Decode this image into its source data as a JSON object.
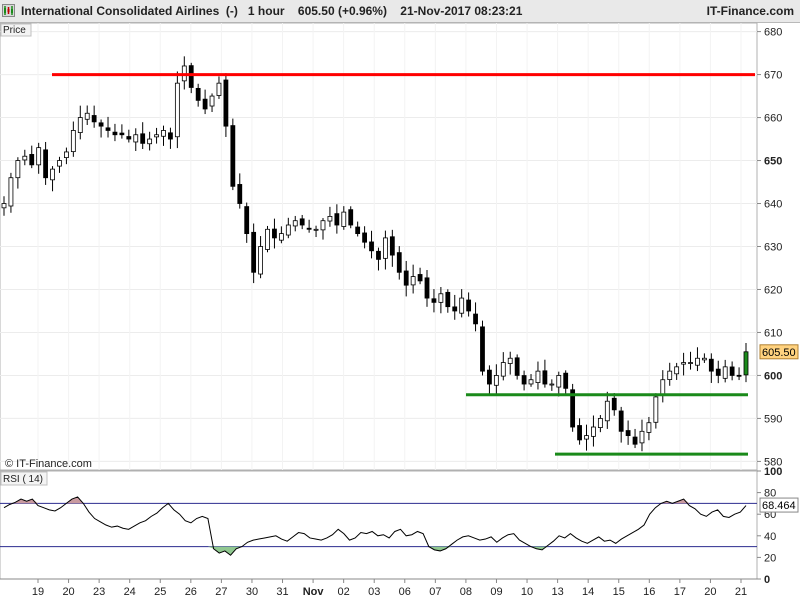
{
  "header": {
    "title": "International Consolidated Airlines  (-)   1 hour    605.50 (+0.96%)    21-Nov-2017 08:23:21",
    "brand": "IT-Finance.com"
  },
  "price_panel": {
    "label": "Price",
    "watermark": "© IT-Finance.com"
  },
  "rsi_panel": {
    "label": "RSI ( 14)"
  },
  "colors": {
    "resistance_line": "#ff0000",
    "support_line": "#1a8a1a",
    "candle": "#000000",
    "bullish": "#1a8a1a",
    "price_tag": "#ffd27f",
    "rsi_overbought_fill": "#c99aa0",
    "rsi_oversold_fill": "#90c890",
    "rsi_line": "#000000",
    "rsi_level_line": "#2b2b8f"
  },
  "chart_data": [
    {
      "type": "candlestick",
      "title": "International Consolidated Airlines",
      "interval": "1 hour",
      "last_price": 605.5,
      "change_pct": "+0.96%",
      "ylim": [
        578,
        682
      ],
      "y_ticks": [
        580,
        590,
        600,
        610,
        620,
        630,
        640,
        650,
        660,
        670,
        680
      ],
      "y_bold_ticks": [
        600,
        650
      ],
      "x_labels": [
        "19",
        "20",
        "23",
        "24",
        "25",
        "26",
        "27",
        "30",
        "31",
        "Nov",
        "02",
        "03",
        "06",
        "07",
        "08",
        "09",
        "10",
        "13",
        "14",
        "15",
        "16",
        "17",
        "20",
        "21"
      ],
      "close_series": [
        640,
        646,
        650,
        651,
        649,
        653,
        646,
        648,
        650,
        652,
        657,
        660,
        661,
        659,
        658,
        657,
        656,
        656,
        655,
        656,
        654,
        655,
        656,
        657,
        655,
        668,
        672,
        667,
        664,
        662,
        665,
        668,
        658,
        644,
        640,
        633,
        624,
        630,
        634,
        632,
        633,
        635,
        636,
        635,
        634,
        634,
        636,
        637,
        635,
        638,
        635,
        633,
        631,
        629,
        627,
        632,
        628,
        624,
        621,
        623,
        622,
        618,
        617,
        619,
        616,
        615,
        618,
        615,
        612,
        601,
        598,
        600,
        603,
        604,
        600,
        598,
        599,
        601,
        598,
        598,
        600,
        597,
        588,
        585,
        586,
        588,
        590,
        594,
        592,
        587,
        586,
        584,
        587,
        589,
        595,
        599,
        601,
        602,
        603,
        603,
        604,
        604,
        601,
        600,
        602,
        600,
        600,
        605.5
      ],
      "price_tag": "605.50",
      "horizontal_lines": [
        {
          "name": "resistance",
          "value": 670,
          "color": "red"
        },
        {
          "name": "support-upper",
          "value": 595.5,
          "color": "green"
        },
        {
          "name": "support-lower",
          "value": 581.7,
          "color": "green"
        }
      ]
    },
    {
      "type": "line",
      "title": "RSI ( 14)",
      "ylim": [
        0,
        100
      ],
      "y_ticks": [
        0,
        20,
        40,
        60,
        80,
        100
      ],
      "y_bold_ticks": [
        0,
        100
      ],
      "levels": [
        70,
        30
      ],
      "last_value": "68.464",
      "values": [
        66,
        69,
        71,
        74,
        72,
        74,
        68,
        66,
        64,
        63,
        66,
        70,
        74,
        76,
        70,
        62,
        56,
        53,
        50,
        48,
        49,
        47,
        46,
        49,
        52,
        54,
        58,
        61,
        66,
        70,
        64,
        60,
        54,
        52,
        56,
        58,
        56,
        28,
        24,
        26,
        22,
        28,
        30,
        34,
        36,
        37,
        38,
        39,
        40,
        37,
        35,
        39,
        43,
        42,
        38,
        37,
        36,
        38,
        41,
        46,
        42,
        36,
        38,
        43,
        42,
        44,
        40,
        41,
        38,
        44,
        46,
        40,
        41,
        44,
        42,
        30,
        27,
        26,
        28,
        32,
        36,
        39,
        40,
        38,
        36,
        37,
        39,
        34,
        38,
        41,
        42,
        36,
        33,
        30,
        28,
        27,
        31,
        35,
        40,
        38,
        42,
        38,
        35,
        33,
        36,
        39,
        35,
        36,
        33,
        37,
        40,
        43,
        46,
        50,
        60,
        66,
        70,
        72,
        70,
        72,
        74,
        68,
        65,
        60,
        58,
        62,
        64,
        58,
        57,
        60,
        62,
        68
      ]
    }
  ]
}
